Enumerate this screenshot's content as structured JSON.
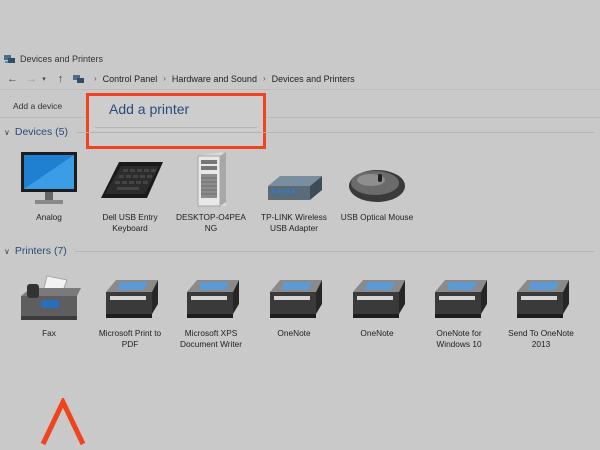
{
  "window": {
    "title": "Devices and Printers"
  },
  "address_bar": {
    "back_icon": "arrow-left-icon",
    "forward_icon": "arrow-right-icon",
    "dropdown_icon": "chevron-down-icon",
    "up_icon": "arrow-up-icon",
    "breadcrumbs": [
      "Control Panel",
      "Hardware and Sound",
      "Devices and Printers"
    ]
  },
  "toolbar": {
    "add_device_label": "Add a device"
  },
  "popup": {
    "add_printer_label": "Add a printer",
    "highlight_color": "#f0431f"
  },
  "devices": {
    "header": "Devices (5)",
    "items": [
      {
        "label": "Analog",
        "icon": "monitor-icon"
      },
      {
        "label": "Dell USB Entry Keyboard",
        "icon": "keyboard-icon"
      },
      {
        "label": "DESKTOP-O4PEA NG",
        "icon": "desktop-tower-icon"
      },
      {
        "label": "TP-LINK Wireless USB Adapter",
        "icon": "usb-adapter-icon"
      },
      {
        "label": "USB Optical Mouse",
        "icon": "mouse-icon"
      }
    ]
  },
  "printers": {
    "header": "Printers (7)",
    "items": [
      {
        "label": "Fax",
        "icon": "fax-icon"
      },
      {
        "label": "Microsoft Print to PDF",
        "icon": "printer-icon"
      },
      {
        "label": "Microsoft XPS Document Writer",
        "icon": "printer-icon"
      },
      {
        "label": "OneNote",
        "icon": "printer-icon"
      },
      {
        "label": "OneNote",
        "icon": "printer-icon"
      },
      {
        "label": "OneNote for Windows 10",
        "icon": "printer-icon"
      },
      {
        "label": "Send To OneNote 2013",
        "icon": "printer-icon"
      }
    ]
  },
  "annotation": {
    "arrow_icon": "caret-up-icon",
    "color": "#f0431f"
  }
}
